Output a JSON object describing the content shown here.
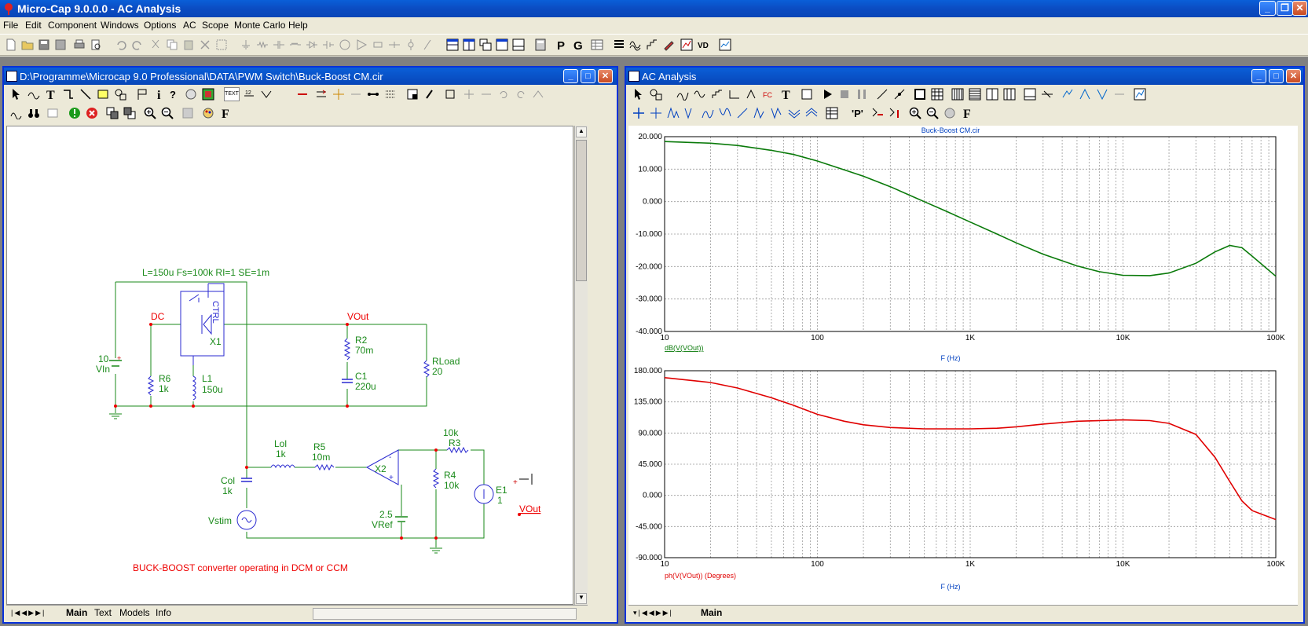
{
  "app": {
    "title": "Micro-Cap 9.0.0.0 - AC Analysis"
  },
  "menu": [
    "File",
    "Edit",
    "Component",
    "Windows",
    "Options",
    "AC",
    "Scope",
    "Monte Carlo",
    "Help"
  ],
  "schematic_window": {
    "title": "D:\\Programme\\Microcap 9.0 Professional\\DATA\\PWM Switch\\Buck-Boost CM.cir",
    "toolbar_text_button": "TEXT",
    "tabs": [
      "Main",
      "Text",
      "Models",
      "Info"
    ],
    "labels": {
      "params": "L=150u Fs=100k RI=1 SE=1m",
      "dc": "DC",
      "vout_top": "VOut",
      "vin_val": "10",
      "vin_name": "VIn",
      "ctrl": "CTRL",
      "x1": "X1",
      "r6_name": "R6",
      "r6_val": "1k",
      "l1_name": "L1",
      "l1_val": "150u",
      "r2_name": "R2",
      "r2_val": "70m",
      "c1_name": "C1",
      "c1_val": "220u",
      "rload_name": "RLoad",
      "rload_val": "20",
      "lol_name": "Lol",
      "lol_val": "1k",
      "r5_name": "R5",
      "r5_val": "10m",
      "col_name": "Col",
      "col_val": "1k",
      "vstim": "Vstim",
      "x2": "X2",
      "r3_val": "10k",
      "r3_name": "R3",
      "r4_name": "R4",
      "r4_val": "10k",
      "vref_val": "2.5",
      "vref_name": "VRef",
      "e1_name": "E1",
      "e1_val": "1",
      "vout_bottom": "VOut",
      "note": "BUCK-BOOST converter operating in DCM or CCM"
    }
  },
  "analysis_window": {
    "title": "AC Analysis",
    "tabs": [
      "Main"
    ],
    "plot_title": "Buck-Boost CM.cir",
    "colors": {
      "magnitude": "#0a7a0a",
      "phase": "#e00000"
    }
  },
  "chart_data": [
    {
      "type": "line",
      "title": "Buck-Boost CM.cir",
      "xlabel": "F (Hz)",
      "ylabel": "dB(V(VOut))",
      "xscale": "log",
      "xlim": [
        10,
        100000
      ],
      "ylim": [
        -40,
        20
      ],
      "x_ticks": [
        "10",
        "100",
        "1K",
        "10K",
        "100K"
      ],
      "y_ticks": [
        "20.000",
        "10.000",
        "0.000",
        "-10.000",
        "-20.000",
        "-30.000",
        "-40.000"
      ],
      "grid": true,
      "series": [
        {
          "name": "dB(V(VOut))",
          "color": "#0a7a0a",
          "x": [
            10,
            20,
            30,
            50,
            70,
            100,
            150,
            200,
            300,
            500,
            700,
            1000,
            1500,
            2000,
            3000,
            5000,
            7000,
            10000,
            15000,
            20000,
            30000,
            40000,
            50000,
            60000,
            70000,
            100000
          ],
          "y": [
            18.5,
            18.0,
            17.3,
            15.8,
            14.5,
            12.5,
            9.8,
            7.8,
            4.6,
            0.0,
            -3.0,
            -6.3,
            -10.0,
            -12.7,
            -16.2,
            -19.8,
            -21.6,
            -22.7,
            -22.8,
            -22.0,
            -19.0,
            -15.5,
            -13.5,
            -14.2,
            -16.8,
            -23.0
          ]
        }
      ]
    },
    {
      "type": "line",
      "xlabel": "F (Hz)",
      "ylabel": "ph(V(VOut)) (Degrees)",
      "xscale": "log",
      "xlim": [
        10,
        100000
      ],
      "ylim": [
        -90,
        180
      ],
      "x_ticks": [
        "10",
        "100",
        "1K",
        "10K",
        "100K"
      ],
      "y_ticks": [
        "180.000",
        "135.000",
        "90.000",
        "45.000",
        "0.000",
        "-45.000",
        "-90.000"
      ],
      "grid": true,
      "series": [
        {
          "name": "ph(V(VOut)) (Degrees)",
          "color": "#e00000",
          "x": [
            10,
            20,
            30,
            50,
            70,
            100,
            150,
            200,
            300,
            500,
            700,
            1000,
            1500,
            2000,
            3000,
            5000,
            7000,
            10000,
            15000,
            20000,
            30000,
            40000,
            50000,
            60000,
            70000,
            100000
          ],
          "y": [
            170,
            163,
            155,
            141,
            130,
            117,
            107,
            102,
            98,
            96,
            96,
            96,
            97,
            99,
            103,
            107,
            108,
            109,
            108,
            104,
            88,
            55,
            20,
            -8,
            -22,
            -35
          ]
        }
      ]
    }
  ]
}
